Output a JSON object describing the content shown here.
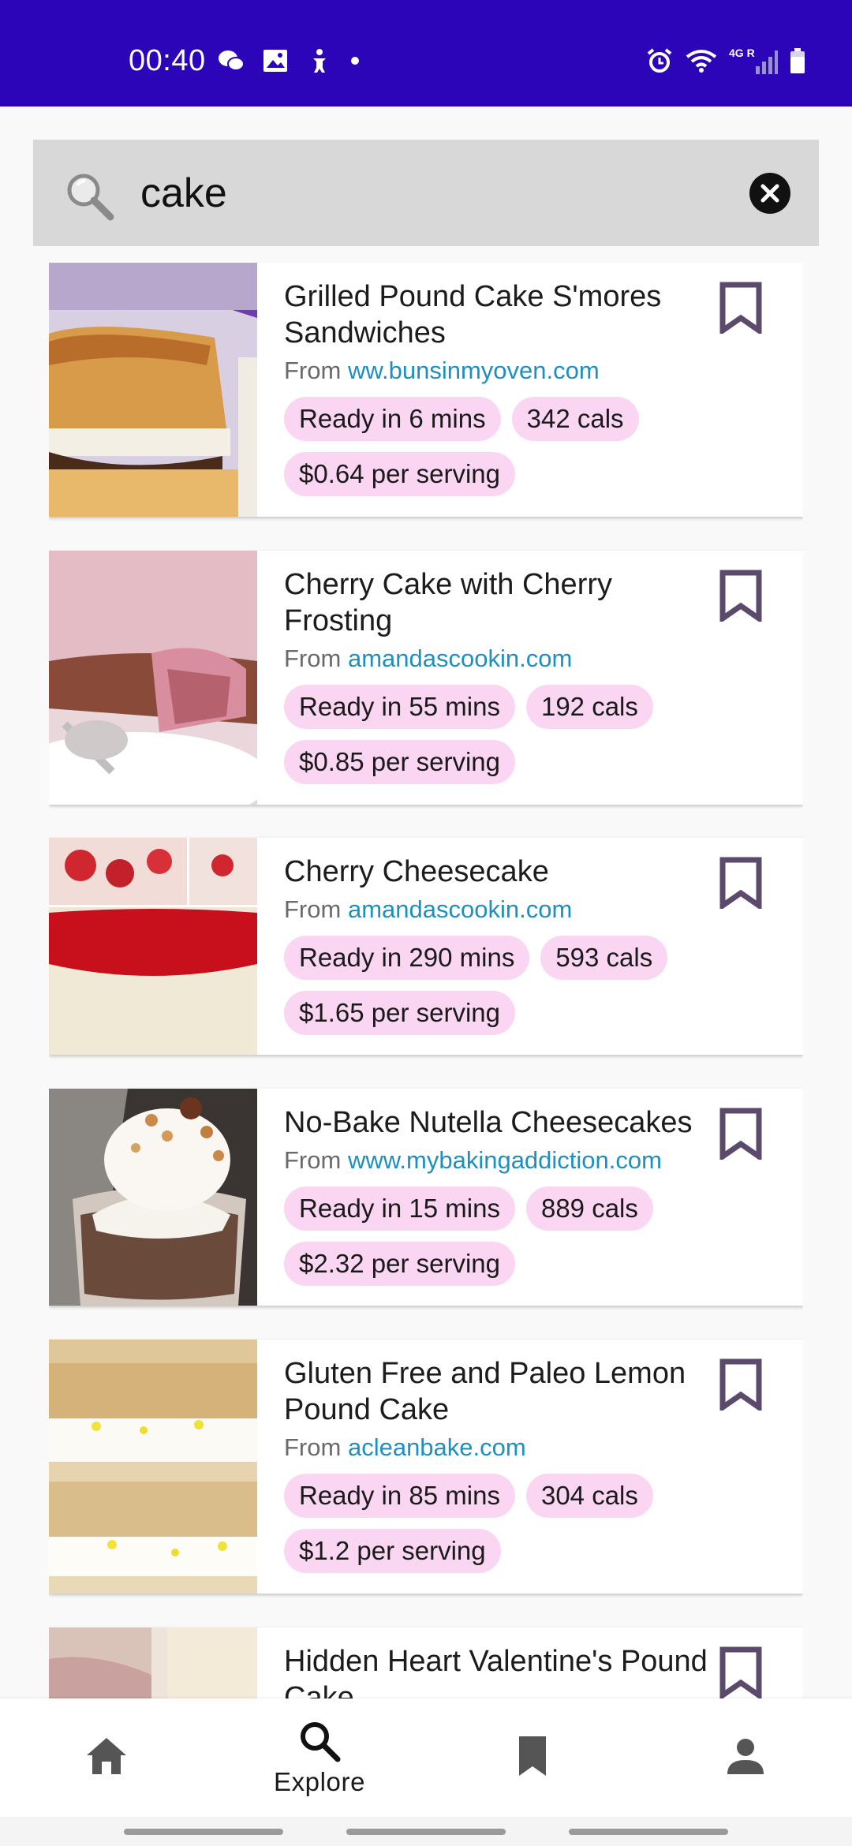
{
  "status_bar": {
    "time": "00:40",
    "left_icons": [
      "wechat-icon",
      "image-icon",
      "accessibility-icon",
      "dot-icon"
    ],
    "right_icons": [
      "alarm-icon",
      "wifi-icon",
      "signal-4g-icon",
      "battery-icon"
    ],
    "network_label": "4G R",
    "background": "#2c05b8"
  },
  "search": {
    "value": "cake",
    "placeholder": ""
  },
  "recipes": [
    {
      "title": "Grilled Pound Cake S'mores Sandwiches",
      "from_label": "From",
      "source": "ww.bunsinmyoven.com",
      "ready": "Ready in 6 mins",
      "cals": "342 cals",
      "price": "$0.64 per serving"
    },
    {
      "title": "Cherry Cake with Cherry Frosting",
      "from_label": "From",
      "source": "amandascookin.com",
      "ready": "Ready in 55 mins",
      "cals": "192 cals",
      "price": "$0.85 per serving"
    },
    {
      "title": "Cherry Cheesecake",
      "from_label": "From",
      "source": "amandascookin.com",
      "ready": "Ready in 290 mins",
      "cals": "593 cals",
      "price": "$1.65 per serving"
    },
    {
      "title": "No-Bake Nutella Cheesecakes",
      "from_label": "From",
      "source": "www.mybakingaddiction.com",
      "ready": "Ready in 15 mins",
      "cals": "889 cals",
      "price": "$2.32 per serving"
    },
    {
      "title": "Gluten Free and Paleo Lemon Pound Cake",
      "from_label": "From",
      "source": "acleanbake.com",
      "ready": "Ready in 85 mins",
      "cals": "304 cals",
      "price": "$1.2 per serving"
    },
    {
      "title": "Hidden Heart Valentine's Pound Cake",
      "from_label": "",
      "source": "",
      "ready": "",
      "cals": "",
      "price": ""
    }
  ],
  "bottom_nav": {
    "items": [
      {
        "icon": "home-icon",
        "label": ""
      },
      {
        "icon": "search-icon",
        "label": "Explore"
      },
      {
        "icon": "bookmark-icon",
        "label": ""
      },
      {
        "icon": "person-icon",
        "label": ""
      }
    ]
  },
  "colors": {
    "accent": "#2c05b8",
    "chip": "#fad6f3",
    "link": "#1e8fbf",
    "bookmark": "#5b4a6b"
  }
}
